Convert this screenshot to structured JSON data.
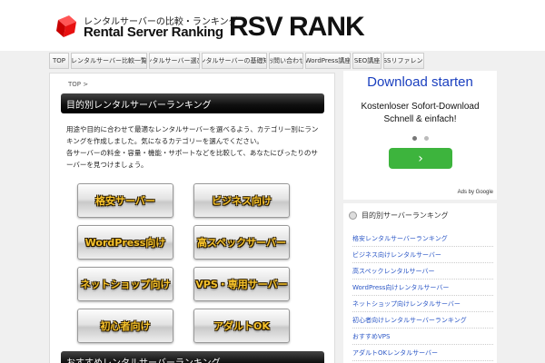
{
  "header": {
    "tagline": "レンタルサーバーの比較・ランキング",
    "title_en": "Rental Server Ranking",
    "title_rank": "RSV RANK"
  },
  "nav": {
    "items": [
      {
        "label": "TOP"
      },
      {
        "label": "レンタルサーバー比較一覧"
      },
      {
        "label": "レンタルサーバー選び方"
      },
      {
        "label": "レンタルサーバーの基礎知識"
      },
      {
        "label": "お問い合わせ"
      },
      {
        "label": "WordPress講座"
      },
      {
        "label": "SEO講座"
      },
      {
        "label": "CSSリファレンス"
      }
    ]
  },
  "main": {
    "breadcrumb": "TOP >",
    "title": "目的別レンタルサーバーランキング",
    "intro": [
      "用途や目的に合わせて最適なレンタルサーバーを選べるよう、カテゴリー別にランキングを作成しました。気になるカテゴリーを選んでください。",
      "各サーバーの料金・容量・機能・サポートなどを比較して、あなたにぴったりのサーバーを見つけましょう。"
    ],
    "categories": [
      {
        "label": "格安サーバー"
      },
      {
        "label": "ビジネス向け"
      },
      {
        "label": "WordPress向け"
      },
      {
        "label": "高スペックサーバー"
      },
      {
        "label": "ネットショップ向け"
      },
      {
        "label": "VPS・専用サーバー"
      },
      {
        "label": "初心者向け"
      },
      {
        "label": "アダルトOK"
      }
    ],
    "bottom_title": "おすすめレンタルサーバーランキング"
  },
  "ad": {
    "headline": "Download starten",
    "line1": "Kostenloser Sofort-Download",
    "line2": "Schnell & einfach!",
    "cta": "›",
    "ads_by": "Ads by Google"
  },
  "sidebar": {
    "heading": "目的別サーバーランキング",
    "links": [
      {
        "label": "格安レンタルサーバーランキング"
      },
      {
        "label": "ビジネス向けレンタルサーバー"
      },
      {
        "label": "高スペックレンタルサーバー"
      },
      {
        "label": "WordPress向けレンタルサーバー"
      },
      {
        "label": "ネットショップ向けレンタルサーバー"
      },
      {
        "label": "初心者向けレンタルサーバーランキング"
      },
      {
        "label": "おすすめVPS"
      },
      {
        "label": "アダルトOKレンタルサーバー"
      }
    ]
  },
  "colors": {
    "accent_blue": "#1a3fbf",
    "link": "#2a56c6",
    "button_text": "#f6c22b",
    "cta_green": "#3db43d"
  }
}
